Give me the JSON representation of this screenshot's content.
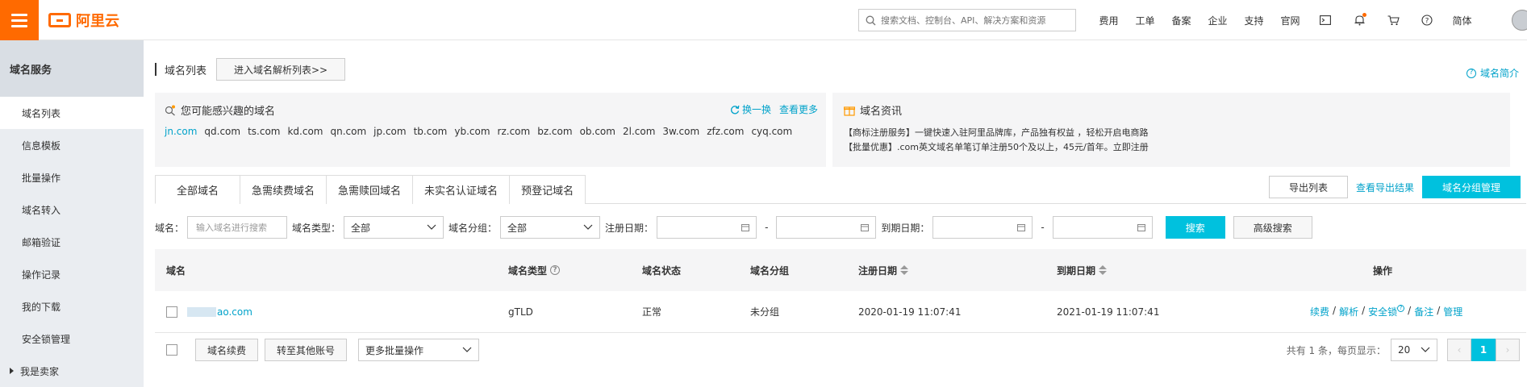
{
  "header": {
    "logo_text": "阿里云",
    "search_placeholder": "搜索文档、控制台、API、解决方案和资源",
    "nav": [
      "费用",
      "工单",
      "备案",
      "企业",
      "支持",
      "官网"
    ],
    "lang": "简体",
    "icons": [
      "terminal-icon",
      "bell-icon",
      "cart-icon",
      "help-icon"
    ]
  },
  "sidebar": {
    "title": "域名服务",
    "items": [
      "域名列表",
      "信息模板",
      "批量操作",
      "域名转入",
      "邮箱验证",
      "操作记录",
      "我的下载",
      "安全锁管理",
      "我是卖家"
    ]
  },
  "main": {
    "title": "域名列表",
    "enter_btn": "进入域名解析列表>>",
    "help": "域名简介",
    "recommend": {
      "title": "您可能感兴趣的域名",
      "refresh": "换一换",
      "more": "查看更多",
      "domains": [
        "jn.com",
        "qd.com",
        "ts.com",
        "kd.com",
        "qn.com",
        "jp.com",
        "tb.com",
        "yb.com",
        "rz.com",
        "bz.com",
        "ob.com",
        "2l.com",
        "3w.com",
        "zfz.com",
        "cyq.com"
      ]
    },
    "news": {
      "title": "域名资讯",
      "items": [
        "【商标注册服务】一键快速入驻阿里品牌库，产品独有权益 ，轻松开启电商路",
        "【批量优惠】.com英文域名单笔订单注册50个及以上，45元/首年。立即注册"
      ]
    },
    "tabs": [
      "全部域名",
      "急需续费域名",
      "急需赎回域名",
      "未实名认证域名",
      "预登记域名"
    ],
    "actions": {
      "export": "导出列表",
      "view_export": "查看导出结果",
      "group_manage": "域名分组管理"
    },
    "filter": {
      "domain_label": "域名：",
      "domain_placeholder": "输入域名进行搜索",
      "type_label": "域名类型：",
      "type_value": "全部",
      "group_label": "域名分组：",
      "group_value": "全部",
      "reg_label": "注册日期：",
      "exp_label": "到期日期：",
      "dash": "-",
      "search": "搜索",
      "advanced": "高级搜索"
    },
    "table": {
      "headers": [
        "域名",
        "域名类型",
        "域名状态",
        "域名分组",
        "注册日期",
        "到期日期",
        "操作"
      ],
      "rows": [
        {
          "domain": "ao.com",
          "type": "gTLD",
          "status": "正常",
          "group": "未分组",
          "reg": "2020-01-19 11:07:41",
          "exp": "2021-01-19 11:07:41",
          "ops": [
            "续费",
            "解析",
            "安全锁",
            "备注",
            "管理"
          ]
        }
      ]
    },
    "footer": {
      "renew": "域名续费",
      "transfer": "转至其他账号",
      "more_batch": "更多批量操作",
      "total": "共有 1 条，每页显示：",
      "page_size": "20",
      "current_page": "1",
      "prev": "‹",
      "next": "›"
    }
  },
  "colors": {
    "brand": "#ff6a00",
    "accent": "#00c1de",
    "link": "#00a2ca"
  }
}
